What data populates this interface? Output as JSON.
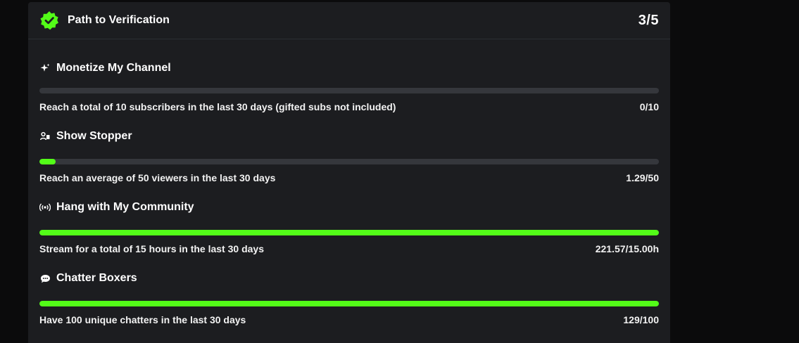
{
  "header": {
    "title": "Path to Verification",
    "count": "3/5",
    "icon": "verified-badge-icon",
    "accent": "#53fc18"
  },
  "goals": [
    {
      "title": "Monetize My Channel",
      "icon": "sparkle-icon",
      "description": "Reach a total of 10 subscribers in the last 30 days (gifted subs not included)",
      "value": "0/10",
      "progress": 0
    },
    {
      "title": "Show Stopper",
      "icon": "viewers-icon",
      "description": "Reach an average of 50 viewers in the last 30 days",
      "value": "1.29/50",
      "progress": 0.0258
    },
    {
      "title": "Hang with My Community",
      "icon": "broadcast-icon",
      "description": "Stream for a total of 15 hours in the last 30 days",
      "value": "221.57/15.00h",
      "progress": 1
    },
    {
      "title": "Chatter Boxers",
      "icon": "chat-bubble-icon",
      "description": "Have 100 unique chatters in the last 30 days",
      "value": "129/100",
      "progress": 1
    }
  ]
}
